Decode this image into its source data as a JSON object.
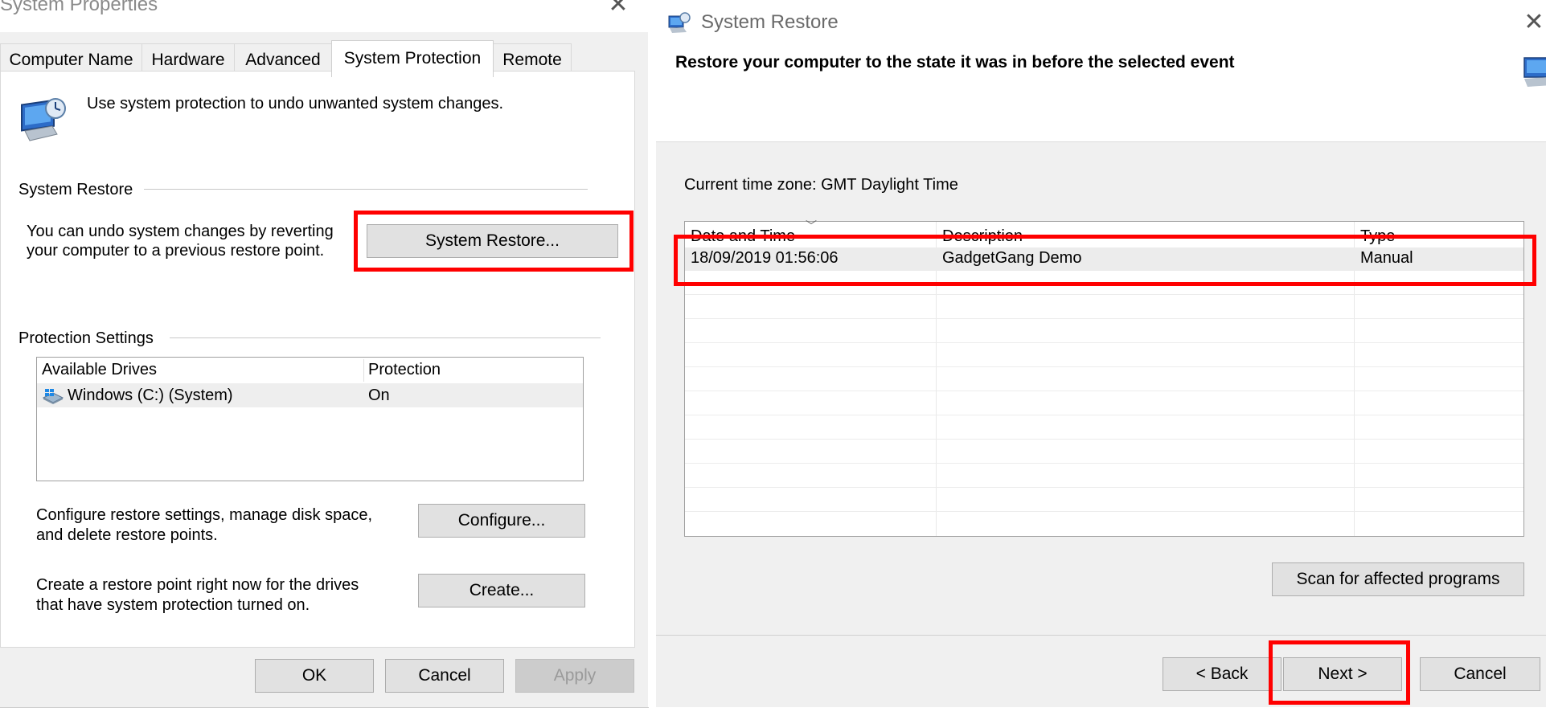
{
  "system_properties": {
    "title": "System Properties",
    "tabs": [
      {
        "label": "Computer Name"
      },
      {
        "label": "Hardware"
      },
      {
        "label": "Advanced"
      },
      {
        "label": "System Protection"
      },
      {
        "label": "Remote"
      }
    ],
    "intro_text": "Use system protection to undo unwanted system changes.",
    "system_restore_group": {
      "heading": "System Restore",
      "description_line1": "You can undo system changes by reverting",
      "description_line2": "your computer to a previous restore point.",
      "button_label": "System Restore..."
    },
    "protection_settings": {
      "heading": "Protection Settings",
      "columns": [
        "Available Drives",
        "Protection"
      ],
      "drives": [
        {
          "name": "Windows (C:) (System)",
          "protection": "On"
        }
      ],
      "configure_text_line1": "Configure restore settings, manage disk space,",
      "configure_text_line2": "and delete restore points.",
      "configure_button": "Configure...",
      "create_text_line1": "Create a restore point right now for the drives",
      "create_text_line2": "that have system protection turned on.",
      "create_button": "Create..."
    },
    "footer": {
      "ok": "OK",
      "cancel": "Cancel",
      "apply": "Apply"
    }
  },
  "system_restore_wizard": {
    "title": "System Restore",
    "heading": "Restore your computer to the state it was in before the selected event",
    "time_zone": "Current time zone: GMT Daylight Time",
    "columns": [
      "Date and Time",
      "Description",
      "Type"
    ],
    "restore_points": [
      {
        "date_time": "18/09/2019 01:56:06",
        "description": "GadgetGang Demo",
        "type": "Manual"
      }
    ],
    "scan_button": "Scan for affected programs",
    "footer": {
      "back": "< Back",
      "next": "Next >",
      "cancel": "Cancel"
    }
  },
  "highlight_color": "#ff0000",
  "icons": [
    "system-protection-icon",
    "drive-icon",
    "restore-wizard-icon",
    "close-icon",
    "sort-indicator-icon"
  ]
}
